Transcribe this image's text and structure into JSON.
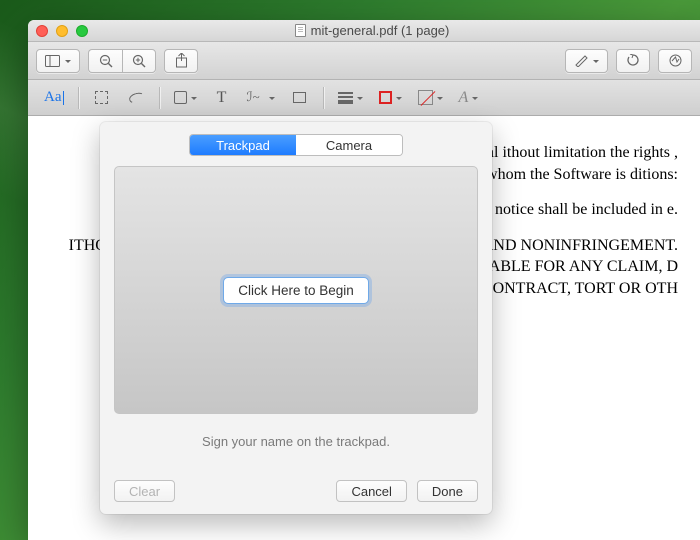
{
  "window": {
    "title": "mit-general.pdf (1 page)"
  },
  "popover": {
    "tabs": {
      "trackpad": "Trackpad",
      "camera": "Camera",
      "active": "trackpad"
    },
    "begin_label": "Click Here to Begin",
    "hint": "Sign your name on the trackpad.",
    "clear_label": "Clear",
    "cancel_label": "Cancel",
    "done_label": "Done"
  },
  "document": {
    "p1": " any person obtaining a copy files (the \"Software\"), to deal ithout limitation the rights , sublicense, and/or sell whom the Software is ditions:",
    "p2": " notice shall be included in e.",
    "p3": "ITHOUT WARRANTY OF AN  TO THE WARRANTIES OF N AND NONINFRINGEMENT. IN AUTHORS OR COPYRIGHT HOLDERS BE LIABLE FOR ANY CLAIM, D LIABILITY, WHETHER IN AN ACTION OF CONTRACT, TORT OR OTH"
  }
}
